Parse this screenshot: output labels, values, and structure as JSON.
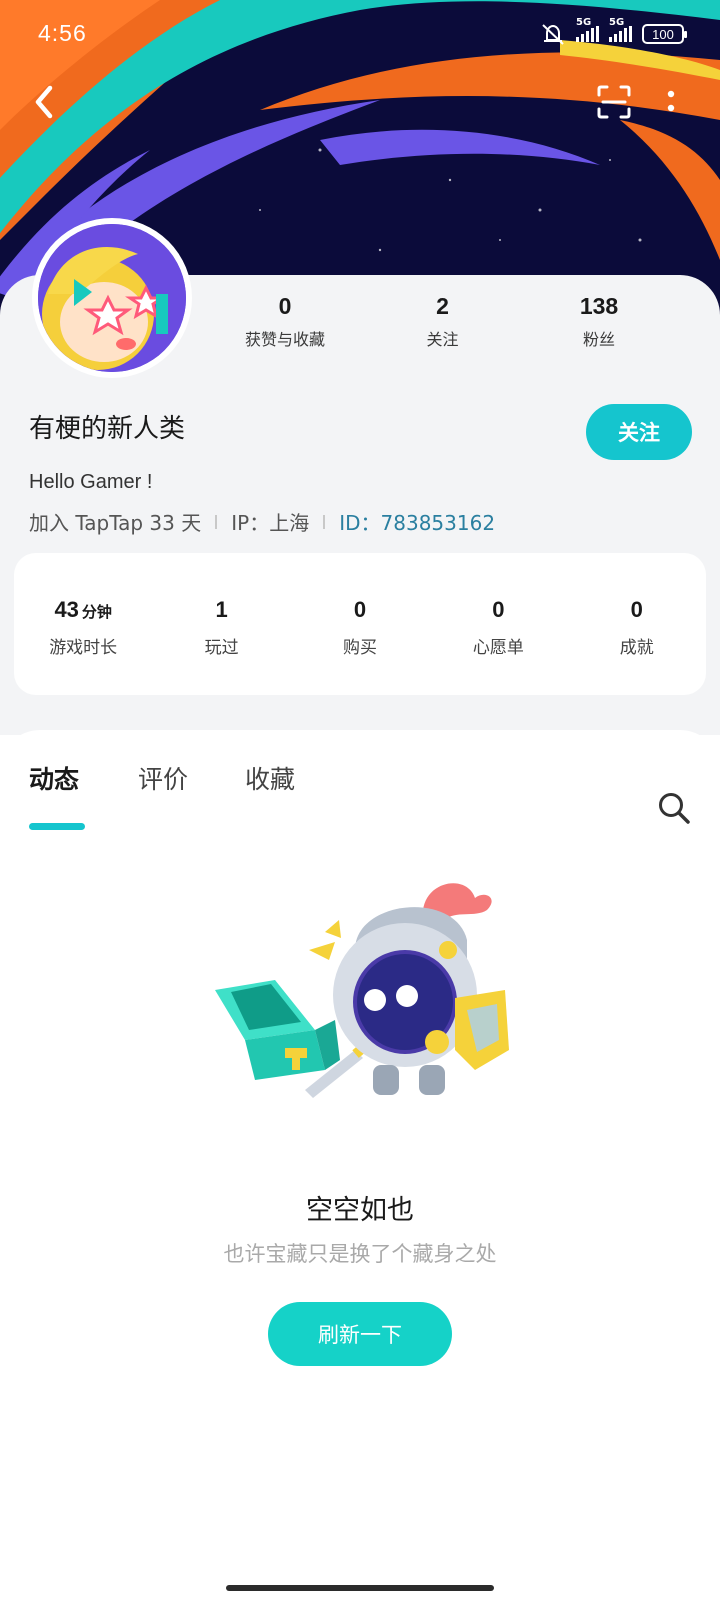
{
  "status_bar": {
    "time": "4:56",
    "network_1": "5G",
    "network_2": "5G",
    "battery": "100",
    "icons": [
      "mute-bell-icon",
      "signal-icon",
      "signal-icon",
      "battery-icon"
    ]
  },
  "nav": {
    "back_icon": "chevron-left-icon",
    "scan_icon": "scan-icon",
    "more_icon": "more-vertical-icon"
  },
  "profile": {
    "username": "有梗的新人类",
    "bio": "Hello Gamer !",
    "joined": "加入 TapTap 33 天",
    "ip": "IP：上海",
    "id_label": "ID：",
    "id_value": "783853162",
    "follow_label": "关注",
    "stats": [
      {
        "value": "0",
        "label": "获赞与收藏"
      },
      {
        "value": "2",
        "label": "关注"
      },
      {
        "value": "138",
        "label": "粉丝"
      }
    ]
  },
  "game_stats": [
    {
      "value": "43",
      "unit": "分钟",
      "label": "游戏时长"
    },
    {
      "value": "1",
      "unit": "",
      "label": "玩过"
    },
    {
      "value": "0",
      "unit": "",
      "label": "购买"
    },
    {
      "value": "0",
      "unit": "",
      "label": "心愿单"
    },
    {
      "value": "0",
      "unit": "",
      "label": "成就"
    }
  ],
  "tabs": {
    "items": [
      {
        "label": "动态",
        "active": true
      },
      {
        "label": "评价",
        "active": false
      },
      {
        "label": "收藏",
        "active": false
      }
    ]
  },
  "empty_state": {
    "title": "空空如也",
    "subtitle": "也许宝藏只是换了个藏身之处",
    "button": "刷新一下"
  },
  "colors": {
    "accent": "#15c5ce",
    "banner_bg": "#0b0b3a",
    "banner_orange": "#f06a1e",
    "banner_teal": "#18c9be",
    "banner_purple": "#6a55e6",
    "id_color": "#2a7fa0"
  }
}
